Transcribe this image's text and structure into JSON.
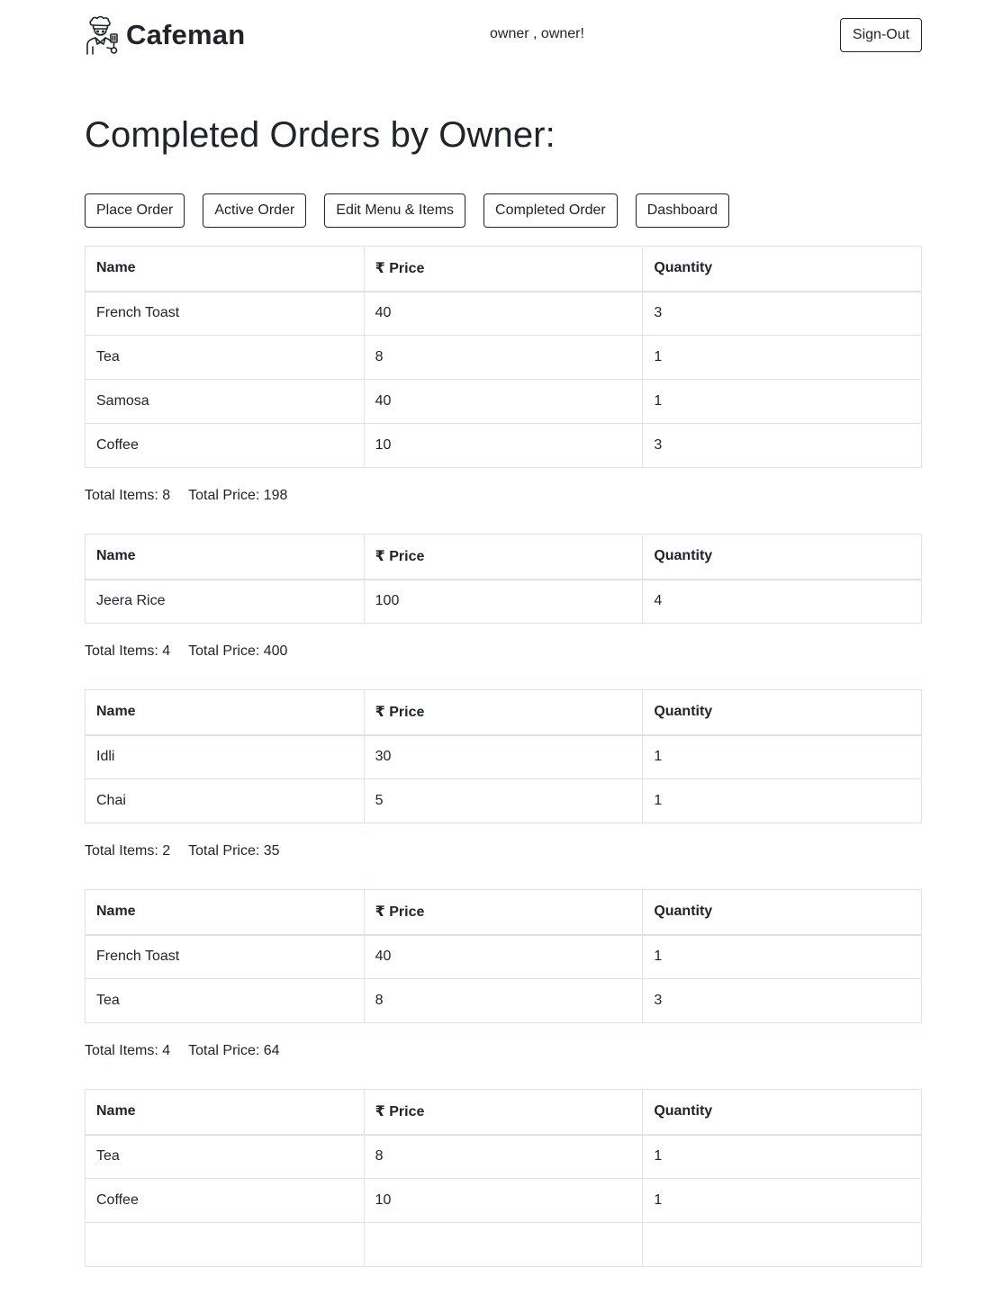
{
  "header": {
    "brand_name": "Cafeman",
    "greeting": "owner , owner!",
    "signout_label": "Sign-Out"
  },
  "page_title": "Completed Orders by Owner:",
  "nav": {
    "place_order": "Place Order",
    "active_order": "Active Order",
    "edit_menu": "Edit Menu & Items",
    "completed_order": "Completed Order",
    "dashboard": "Dashboard"
  },
  "table_headers": {
    "name": "Name",
    "currency_symbol": "₹",
    "price": "Price",
    "quantity": "Quantity"
  },
  "orders": [
    {
      "items": [
        {
          "name": "French Toast",
          "price": "40",
          "quantity": "3"
        },
        {
          "name": "Tea",
          "price": "8",
          "quantity": "1"
        },
        {
          "name": "Samosa",
          "price": "40",
          "quantity": "1"
        },
        {
          "name": "Coffee",
          "price": "10",
          "quantity": "3"
        }
      ],
      "total_items": "Total Items: 8",
      "total_price": "Total Price: 198"
    },
    {
      "items": [
        {
          "name": "Jeera Rice",
          "price": "100",
          "quantity": "4"
        }
      ],
      "total_items": "Total Items: 4",
      "total_price": "Total Price: 400"
    },
    {
      "items": [
        {
          "name": "Idli",
          "price": "30",
          "quantity": "1"
        },
        {
          "name": "Chai",
          "price": "5",
          "quantity": "1"
        }
      ],
      "total_items": "Total Items: 2",
      "total_price": "Total Price: 35"
    },
    {
      "items": [
        {
          "name": "French Toast",
          "price": "40",
          "quantity": "1"
        },
        {
          "name": "Tea",
          "price": "8",
          "quantity": "3"
        }
      ],
      "total_items": "Total Items: 4",
      "total_price": "Total Price: 64"
    },
    {
      "items": [
        {
          "name": "Tea",
          "price": "8",
          "quantity": "1"
        },
        {
          "name": "Coffee",
          "price": "10",
          "quantity": "1"
        },
        {
          "name": "",
          "price": "",
          "quantity": ""
        }
      ],
      "total_items": "",
      "total_price": ""
    }
  ],
  "icons": {
    "logo": "chef-icon"
  }
}
